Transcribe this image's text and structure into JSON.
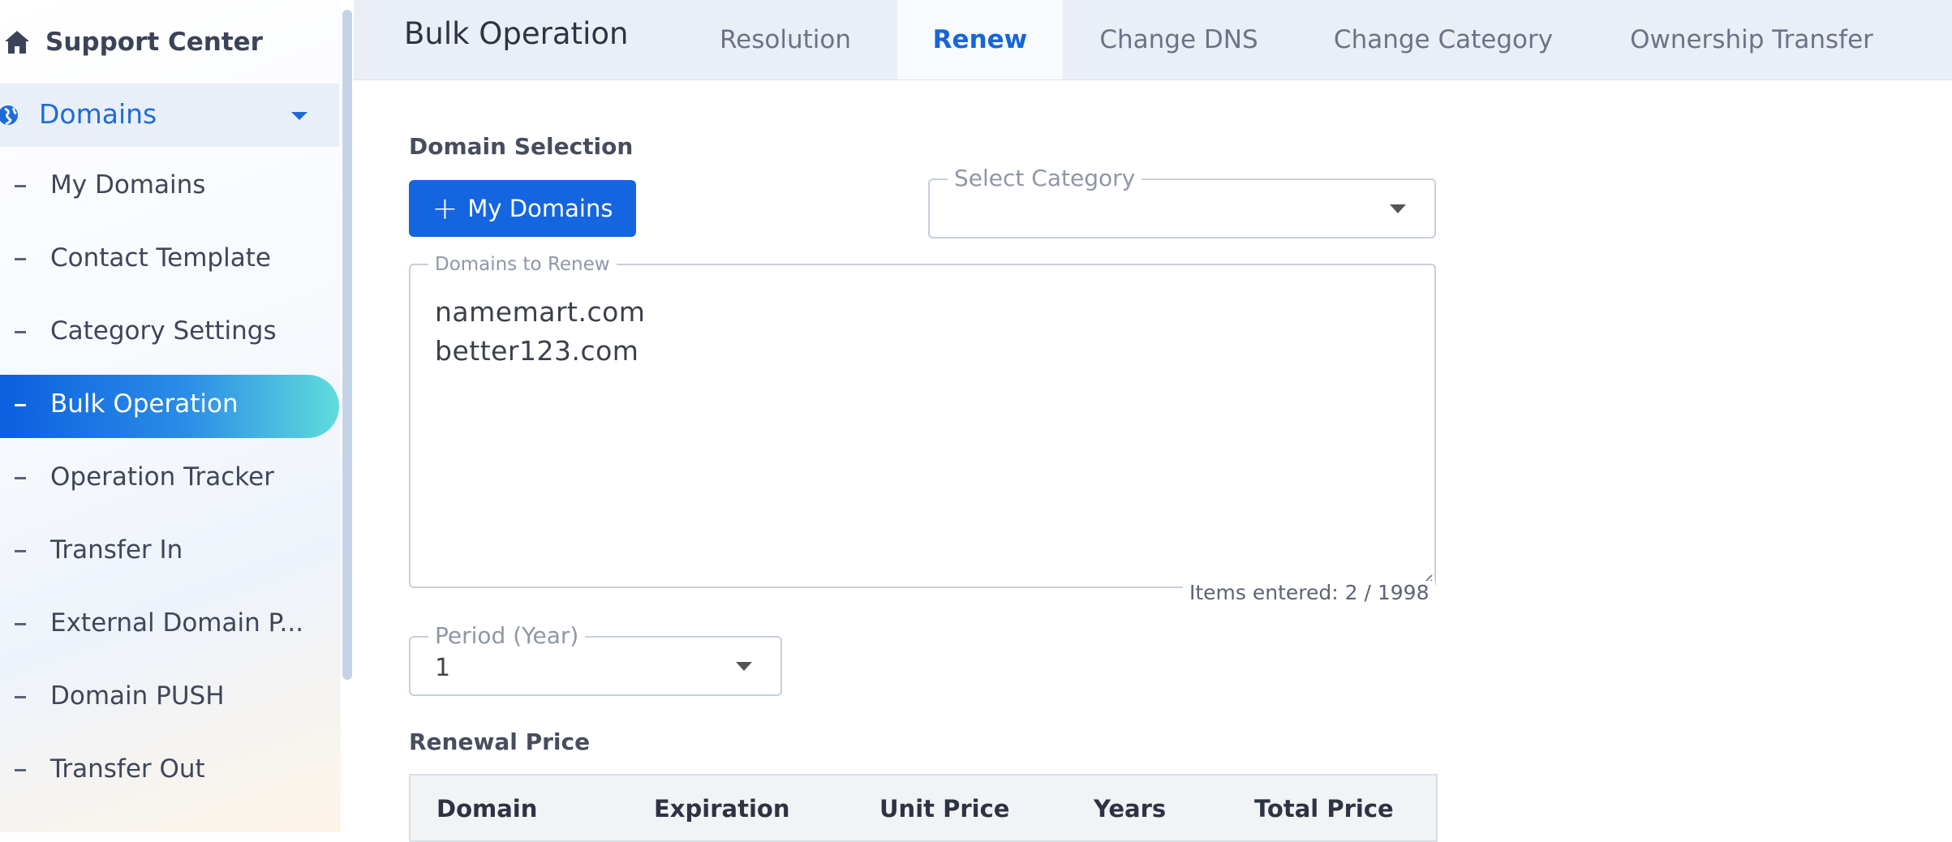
{
  "sidebar": {
    "header": {
      "label": "Support Center",
      "icon": "home-icon"
    },
    "group": {
      "label": "Domains",
      "icon": "globe-icon",
      "expanded": true
    },
    "items": [
      {
        "label": "My Domains"
      },
      {
        "label": "Contact Template"
      },
      {
        "label": "Category Settings"
      },
      {
        "label": "Bulk Operation",
        "active": true
      },
      {
        "label": "Operation Tracker"
      },
      {
        "label": "Transfer In"
      },
      {
        "label": "External Domain P..."
      },
      {
        "label": "Domain PUSH"
      },
      {
        "label": "Transfer Out"
      }
    ]
  },
  "header": {
    "title": "Bulk Operation",
    "tabs": [
      {
        "label": "Resolution"
      },
      {
        "label": "Renew",
        "active": true
      },
      {
        "label": "Change DNS"
      },
      {
        "label": "Change Category"
      },
      {
        "label": "Ownership Transfer"
      }
    ]
  },
  "main": {
    "domain_selection_label": "Domain Selection",
    "my_domains_button": "My Domains",
    "select_category": {
      "legend": "Select Category",
      "value": ""
    },
    "domains_to_renew": {
      "legend": "Domains to Renew",
      "lines": [
        "namemart.com",
        "better123.com"
      ]
    },
    "items_entered": "Items entered: 2 / 1998",
    "period": {
      "legend": "Period (Year)",
      "value": "1"
    },
    "renewal_price_label": "Renewal Price",
    "table_headers": [
      "Domain",
      "Expiration",
      "Unit Price",
      "Years",
      "Total Price"
    ]
  },
  "colors": {
    "accent": "#1565e0",
    "active_tab_text": "#1766d6",
    "sidebar_active_gradient_start": "#0b5fe0",
    "sidebar_active_gradient_end": "#5fdcdc"
  }
}
